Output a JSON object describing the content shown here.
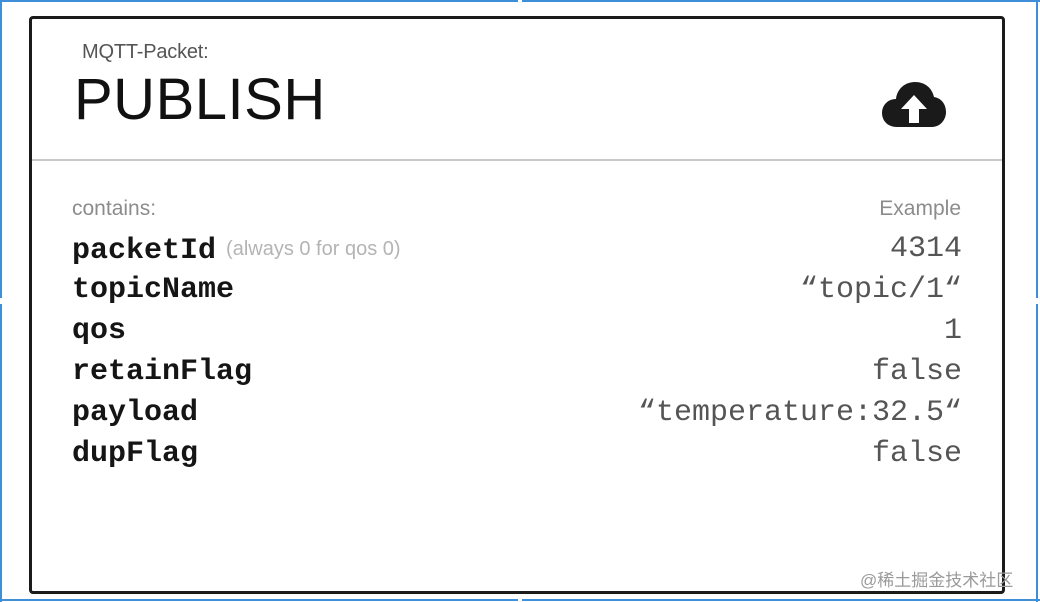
{
  "header": {
    "kicker": "MQTT-Packet:",
    "title": "PUBLISH",
    "icon": "cloud-upload-icon"
  },
  "table": {
    "left_heading": "contains:",
    "right_heading": "Example",
    "rows": [
      {
        "name": "packetId",
        "note": "(always 0 for qos 0)",
        "value": "4314"
      },
      {
        "name": "topicName",
        "note": "",
        "value": "“topic/1“"
      },
      {
        "name": "qos",
        "note": "",
        "value": "1"
      },
      {
        "name": "retainFlag",
        "note": "",
        "value": "false"
      },
      {
        "name": "payload",
        "note": "",
        "value": "“temperature:32.5“"
      },
      {
        "name": "dupFlag",
        "note": "",
        "value": "false"
      }
    ]
  },
  "watermark": "@稀土掘金技术社区",
  "colors": {
    "frame_accent": "#3f8fd8",
    "card_border": "#1b1b1b",
    "divider": "#c9c9c9"
  }
}
